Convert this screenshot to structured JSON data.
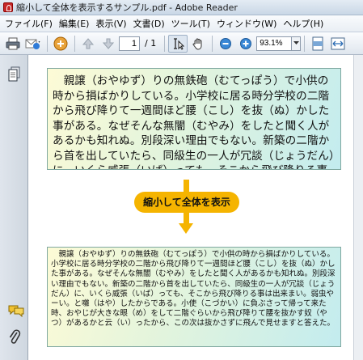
{
  "window": {
    "title": "縮小して全体を表示するサンプル.pdf - Adobe Reader"
  },
  "menu": {
    "items": [
      {
        "label": "ファイル(F)"
      },
      {
        "label": "編集(E)"
      },
      {
        "label": "表示(V)"
      },
      {
        "label": "文書(D)"
      },
      {
        "label": "ツール(T)"
      },
      {
        "label": "ウィンドウ(W)"
      },
      {
        "label": "ヘルプ(H)"
      }
    ]
  },
  "toolbar": {
    "page_current": "1",
    "page_total": "/ 1",
    "zoom": "93.1%"
  },
  "document": {
    "top_text": "親譲（おやゆず）りの無鉄砲（むてっぽう）で小供の時から損ばかりしている。小学校に居る時分学校の二階から飛び降りて一週間ほど腰（こし）を抜（ぬ）かした事がある。なぜそんな無闇（むやみ）をしたと聞く人があるかも知れぬ。別段深い理由でもない。新築の二階から首を出していたら、同級生の一人が冗談（じょうだん）に、いくら威張（いば）っても、そこから飛び降りる事は出来まい",
    "callout": "縮小して全体を表示",
    "bottom_text": "親譲（おやゆず）りの無鉄砲（むてっぽう）で小供の時から損ばかりしている。小学校に居る時分学校の二階から飛び降りて一週間ほど腰（こし）を抜（ぬ）かした事がある。なぜそんな無闇（むやみ）をしたと聞く人があるかも知れぬ。別段深い理由でもない。新築の二階から首を出していたら、同級生の一人が冗談（じょうだん）に、いくら威張（いば）っても、そこから飛び降りる事は出来まい。弱虫やーい。と囃（はや）したからである。小使（こづかい）に負ぶさって帰って来た時、おやじが大きな眼（め）をして二階ぐらいから飛び降りて腰を抜かす奴（やつ）があるかと云（い）ったから、この次は抜かさずに飛んで見せますと答えた。"
  },
  "colors": {
    "callout": "#f5b400",
    "panel_start": "#fdfbd6",
    "panel_end": "#c3ecef"
  },
  "icons": {
    "titlebar": "adobe-reader-icon",
    "print": "printer-icon",
    "email": "email-icon",
    "prev": "arrow-up-icon",
    "next": "arrow-down-icon",
    "select": "select-text-icon",
    "hand": "hand-icon",
    "zoom_out": "zoom-out-icon",
    "zoom_in": "zoom-in-icon",
    "fit": "fit-page-icon",
    "sidebar_pages": "pages-icon",
    "sidebar_comments": "comments-icon",
    "sidebar_attach": "attachment-icon"
  }
}
